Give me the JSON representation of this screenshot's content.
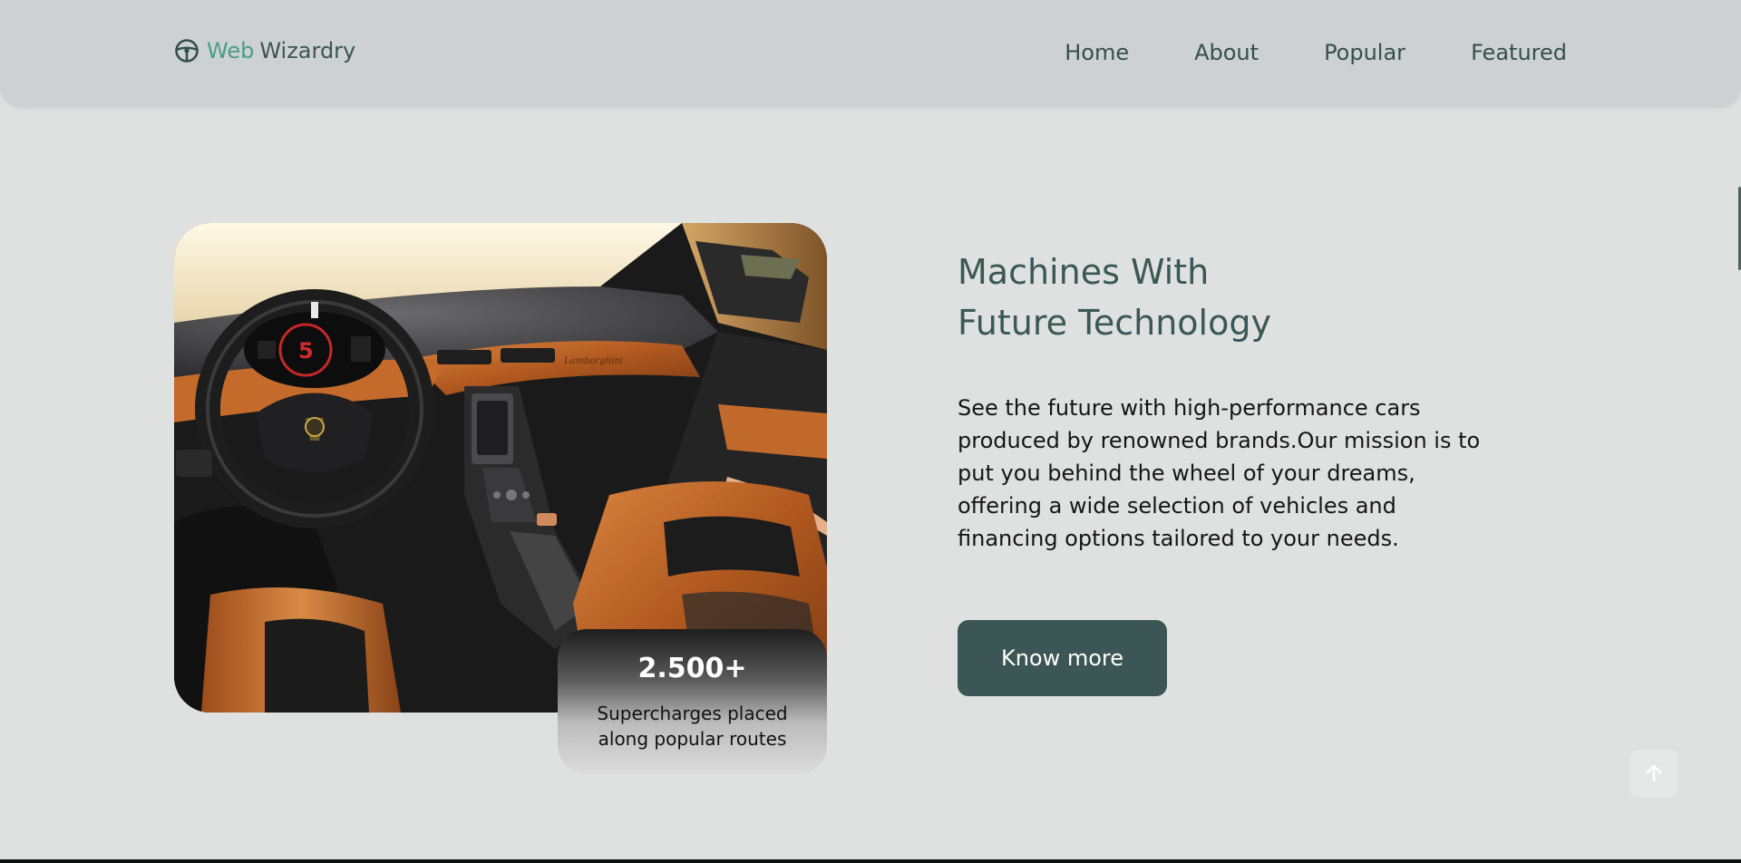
{
  "header": {
    "logo_icon": "steering-wheel-icon",
    "brand_part1": "Web",
    "brand_part2": "Wizardry",
    "nav": [
      "Home",
      "About",
      "Popular",
      "Featured"
    ]
  },
  "hero": {
    "image_alt": "Supercar interior",
    "stat": {
      "number": "2.500+",
      "label": "Supercharges placed along popular routes"
    },
    "headline_line1": "Machines With",
    "headline_line2": "Future Technology",
    "description": "See the future with high-performance cars produced by renowned brands.Our mission is to put you behind the wheel of your dreams, offering a wide selection of vehicles and financing options tailored to your needs.",
    "cta": "Know more"
  },
  "scroll_top_icon": "arrow-up-icon",
  "colors": {
    "accent": "#3b5654",
    "brand_green": "#4a9e85",
    "background": "#dfe1e0",
    "header_bg": "#cdd1d2"
  }
}
